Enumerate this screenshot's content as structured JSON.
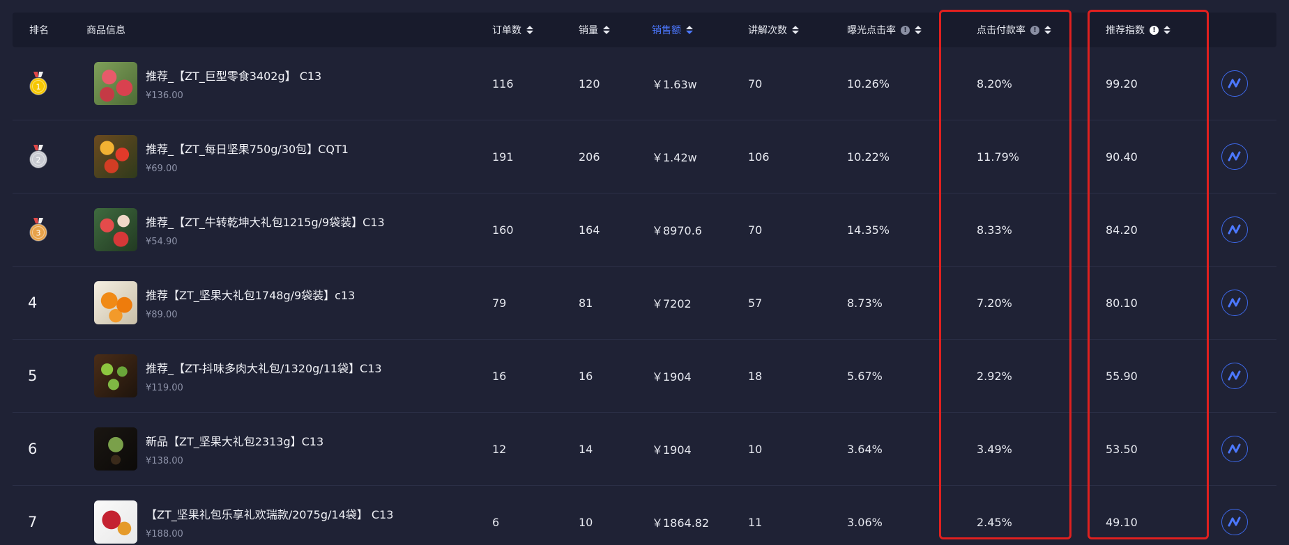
{
  "header": {
    "rank": "排名",
    "product": "商品信息",
    "orders": "订单数",
    "sales": "销量",
    "revenue": "销售额",
    "explain": "讲解次数",
    "ctr": "曝光点击率",
    "cvr": "点击付款率",
    "score": "推荐指数"
  },
  "rows": [
    {
      "rank": "1",
      "name": "推荐_【ZT_巨型零食3402g】 C13",
      "price": "¥136.00",
      "orders": "116",
      "sales": "120",
      "revenue": "￥1.63w",
      "explain": "70",
      "ctr": "10.26%",
      "cvr": "8.20%",
      "score": "99.20"
    },
    {
      "rank": "2",
      "name": "推荐_【ZT_每日坚果750g/30包】CQT1",
      "price": "¥69.00",
      "orders": "191",
      "sales": "206",
      "revenue": "￥1.42w",
      "explain": "106",
      "ctr": "10.22%",
      "cvr": "11.79%",
      "score": "90.40"
    },
    {
      "rank": "3",
      "name": "推荐_【ZT_牛转乾坤大礼包1215g/9袋装】C13",
      "price": "¥54.90",
      "orders": "160",
      "sales": "164",
      "revenue": "￥8970.6",
      "explain": "70",
      "ctr": "14.35%",
      "cvr": "8.33%",
      "score": "84.20"
    },
    {
      "rank": "4",
      "name": "推荐【ZT_坚果大礼包1748g/9袋装】c13",
      "price": "¥89.00",
      "orders": "79",
      "sales": "81",
      "revenue": "￥7202",
      "explain": "57",
      "ctr": "8.73%",
      "cvr": "7.20%",
      "score": "80.10"
    },
    {
      "rank": "5",
      "name": "推荐_【ZT-抖味多肉大礼包/1320g/11袋】C13",
      "price": "¥119.00",
      "orders": "16",
      "sales": "16",
      "revenue": "￥1904",
      "explain": "18",
      "ctr": "5.67%",
      "cvr": "2.92%",
      "score": "55.90"
    },
    {
      "rank": "6",
      "name": "新品【ZT_坚果大礼包2313g】C13",
      "price": "¥138.00",
      "orders": "12",
      "sales": "14",
      "revenue": "￥1904",
      "explain": "10",
      "ctr": "3.64%",
      "cvr": "3.49%",
      "score": "53.50"
    },
    {
      "rank": "7",
      "name": "【ZT_坚果礼包乐享礼欢瑞款/2075g/14袋】 C13",
      "price": "¥188.00",
      "orders": "6",
      "sales": "10",
      "revenue": "￥1864.82",
      "explain": "11",
      "ctr": "3.06%",
      "cvr": "2.45%",
      "score": "49.10"
    }
  ],
  "colors": {
    "accent": "#4c78ff",
    "highlight": "#e0201f",
    "gold": "#f6c700",
    "silver": "#c9cbd2",
    "bronze": "#e7a24a"
  }
}
